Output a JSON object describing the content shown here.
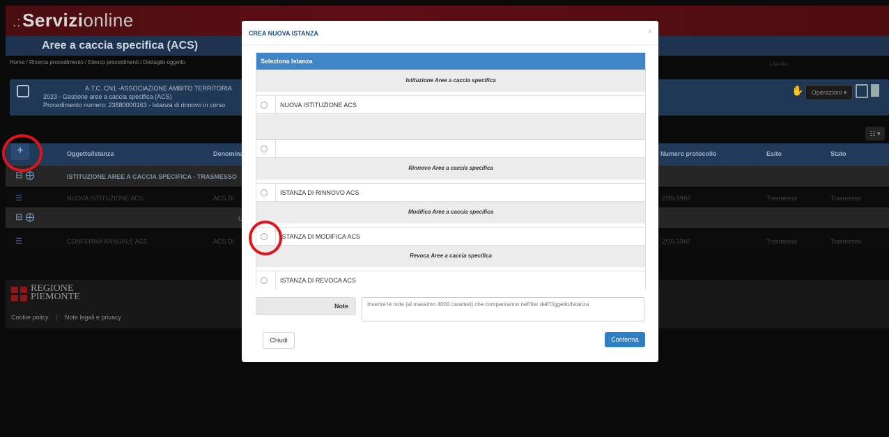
{
  "app": {
    "logo_prefix": ".:",
    "logo_bold": "Servizi",
    "logo_rest": "online",
    "page_title": "Aree a caccia specifica (ACS)",
    "breadcrumb": "Home  /  Ricerca procedimento  /  Elenco procedimenti  /  Dettaglio oggetto",
    "user": "Utente"
  },
  "info": {
    "line1": "A.T.C. CN1 -ASSOCIAZIONE AMBITO TERRITORIA",
    "line2": "2023 - Gestione aree a caccia specifica (ACS)",
    "line3": "Procedimento numero: 23880000163 - Istanza di rinnovo in corso",
    "operations_label": "Operazioni ▾"
  },
  "table": {
    "headers": [
      "Oggetto/Istanza",
      "Denomina",
      "Numero protocollo",
      "Esito",
      "Stato"
    ],
    "group1_title": "ISTITUZIONE AREE A CACCIA SPECIFICA - TRASMESSO",
    "row1": [
      "NUOVA ISTITUZIONE ACS",
      "ACS DI",
      "2/35-39AF",
      "Trasmesso",
      "Trasmesso"
    ],
    "group2_title": "U",
    "row2": [
      "CONFERMA ANNUALE ACS",
      "ACS DI",
      "2/35-39AF",
      "Trasmesso",
      "Trasmesso"
    ],
    "columns_btn": "☷ ▾"
  },
  "footer": {
    "region_line1": "REGIONE",
    "region_line2": "PIEMONTE",
    "cookie": "Cookie policy",
    "legal": "Note legali e privacy"
  },
  "modal": {
    "title": "CREA NUOVA ISTANZA",
    "close_x": "×",
    "panel_title": "Seleziona Istanza",
    "sections": [
      {
        "title": "Istituzione Aree a caccia specifica"
      },
      {
        "title": ""
      },
      {
        "title": "Rinnovo Aree a caccia specifica"
      },
      {
        "title": "Modifica Aree a caccia specifica"
      },
      {
        "title": "Revoca Aree a caccia specifica"
      }
    ],
    "options": [
      {
        "label": "NUOVA ISTITUZIONE ACS"
      },
      {
        "label": ""
      },
      {
        "label": "ISTANZA DI RINNOVO ACS"
      },
      {
        "label": "ISTANZA DI MODIFICA ACS"
      },
      {
        "label": "ISTANZA DI REVOCA ACS"
      }
    ],
    "note_label": "Note",
    "note_placeholder": "Inserire le note (al massimo 4000 caratteri) che compariranno nell'iter dell'Oggetto/Istanza",
    "close_button": "Chiudi",
    "confirm_button": "Conferma"
  },
  "colors": {
    "modal_header_text": "#1e4f86",
    "panel_header": "#3f86c8",
    "confirm_button": "#2f7fc4",
    "annotation_circle": "#e0141b"
  }
}
